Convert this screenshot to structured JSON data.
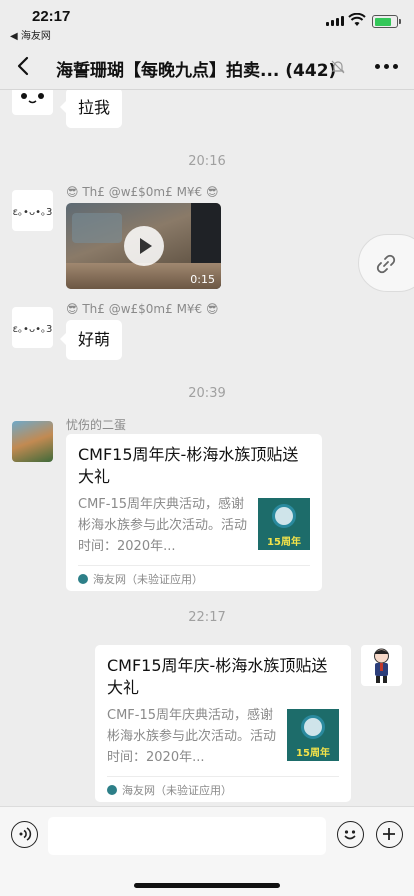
{
  "status_bar": {
    "time": "22:17",
    "back_app": "◀ 海友网"
  },
  "nav": {
    "title": "海誓珊瑚【每晚九点】拍卖... (442)"
  },
  "messages": {
    "m1": {
      "text": "拉我"
    },
    "t1": "20:16",
    "m2": {
      "avatar_text": "ε｡•ᴗ•｡3",
      "sender": "😎 Th£ @w£$0m£ M¥€ 😎",
      "video_duration": "0:15"
    },
    "m3": {
      "avatar_text": "ε｡•ᴗ•｡3",
      "sender": "😎 Th£ @w£$0m£ M¥€ 😎",
      "text": "好萌"
    },
    "t2": "20:39",
    "m4": {
      "sender": "忧伤的二蛋",
      "card_title": "CMF15周年庆-彬海水族顶贴送大礼",
      "card_desc": "CMF-15周年庆典活动，感谢彬海水族参与此次活动。活动时间：2020年...",
      "thumb_label": "15周年",
      "source": "海友网（未验证应用）"
    },
    "t3": "22:17",
    "m5": {
      "card_title": "CMF15周年庆-彬海水族顶贴送大礼",
      "card_desc": "CMF-15周年庆典活动，感谢彬海水族参与此次活动。活动时间：2020年...",
      "thumb_label": "15周年",
      "source": "海友网（未验证应用）"
    }
  },
  "colors": {
    "accent_battery": "#34c759",
    "background": "#ededed",
    "thumb_bg": "#1d6c6a"
  }
}
